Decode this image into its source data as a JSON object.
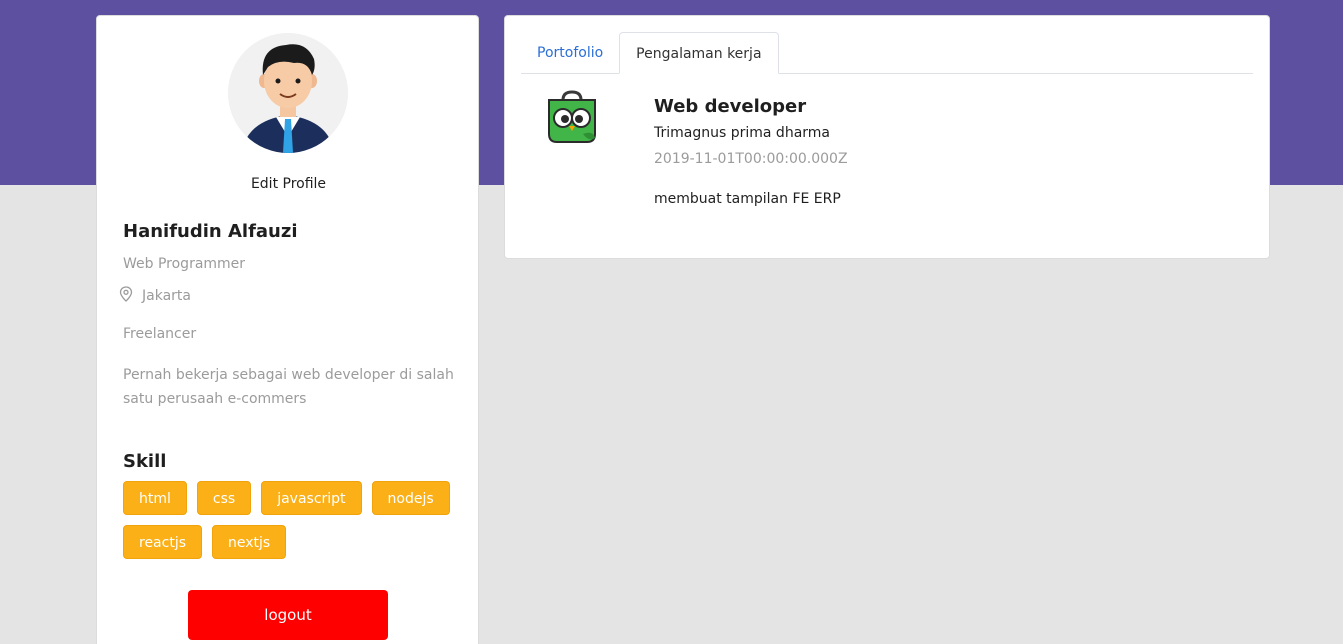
{
  "profile": {
    "edit_label": "Edit Profile",
    "name": "Hanifudin Alfauzi",
    "job": "Web Programmer",
    "location": "Jakarta",
    "status": "Freelancer",
    "description": "Pernah bekerja sebagai web developer di salah satu perusaah e-commers",
    "skill_title": "Skill",
    "skills": [
      "html",
      "css",
      "javascript",
      "nodejs",
      "reactjs",
      "nextjs"
    ],
    "logout_label": "logout"
  },
  "tabs": [
    {
      "label": "Portofolio",
      "active": false
    },
    {
      "label": "Pengalaman kerja",
      "active": true
    }
  ],
  "experience": {
    "position": "Web developer",
    "company": "Trimagnus prima dharma",
    "date": "2019-11-01T00:00:00.000Z",
    "description": "membuat tampilan FE ERP",
    "logo_icon": "owl-bag-logo-icon"
  },
  "colors": {
    "header_purple": "#5e50a1",
    "skill_badge": "#fbb017",
    "logout_red": "#ff0000",
    "link_blue": "#2b6fd6"
  }
}
